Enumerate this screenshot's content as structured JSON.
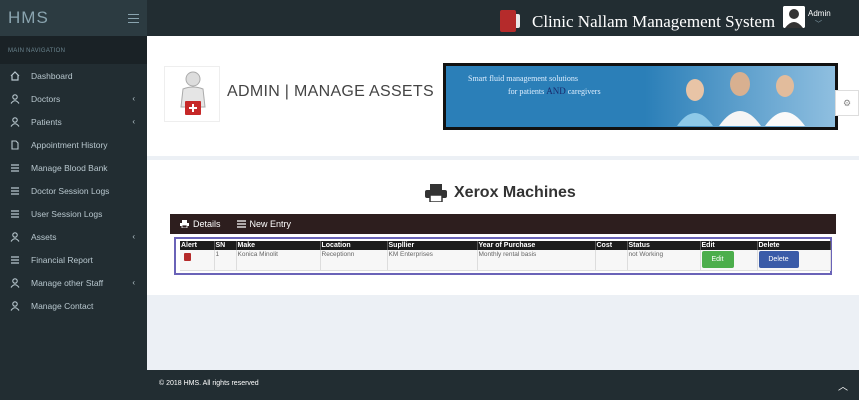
{
  "brand": "HMS",
  "header": {
    "title": "Clinic Nallam Management System",
    "user": "Admin"
  },
  "sidebar": {
    "section": "MAIN NAVIGATION",
    "items": [
      {
        "label": "Dashboard",
        "icon": "home-icon"
      },
      {
        "label": "Doctors",
        "icon": "user-icon"
      },
      {
        "label": "Patients",
        "icon": "user-icon"
      },
      {
        "label": "Appointment History",
        "icon": "file-icon"
      },
      {
        "label": "Manage Blood Bank",
        "icon": "list-icon"
      },
      {
        "label": "Doctor Session Logs",
        "icon": "list-icon"
      },
      {
        "label": "User Session Logs",
        "icon": "list-icon"
      },
      {
        "label": "Assets",
        "icon": "user-icon"
      },
      {
        "label": "Financial Report",
        "icon": "list-icon"
      },
      {
        "label": "Manage other Staff",
        "icon": "user-icon"
      },
      {
        "label": "Manage Contact",
        "icon": "user-icon"
      }
    ]
  },
  "page": {
    "heading": "ADMIN | MANAGE ASSETS",
    "banner_line1": "Smart fluid management solutions",
    "banner_line2": "for patients",
    "banner_and": "AND",
    "banner_line3": "caregivers",
    "section_title": "Xerox Machines"
  },
  "tabs": {
    "details": "Details",
    "new_entry": "New Entry"
  },
  "table": {
    "headers": [
      "Alert",
      "SN",
      "Make",
      "Location",
      "Supllier",
      "Year of Purchase",
      "Cost",
      "Status",
      "Edit",
      "Delete"
    ],
    "rows": [
      {
        "sn": "1",
        "make": "Konica Minolit",
        "location": "Receptionn",
        "supplier": "KM Enterprises",
        "year": "Monthly rental basis",
        "cost": "",
        "status": "not Working",
        "edit": "Edit",
        "delete": "Delete"
      }
    ]
  },
  "footer": {
    "text": "© 2018 HMS. All rights reserved"
  },
  "colors": {
    "sidebar": "#222d32",
    "header": "#222d32",
    "edit": "#4cae4c",
    "delete": "#3a5ba8",
    "alert": "#b52b2b"
  }
}
